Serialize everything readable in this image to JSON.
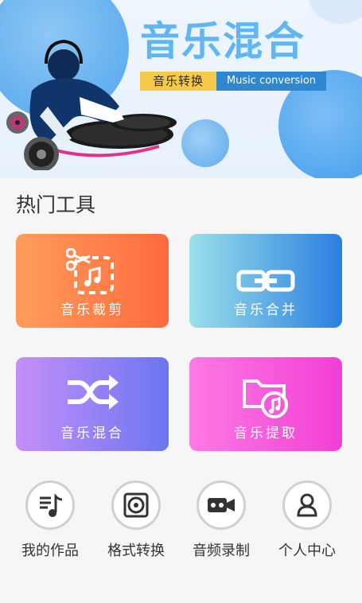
{
  "banner": {
    "title": "音乐混合",
    "tag_cn": "音乐转换",
    "tag_en": "Music conversion"
  },
  "section": {
    "title": "热门工具"
  },
  "tools": [
    {
      "label": "音乐裁剪",
      "icon": "scissors-music-icon",
      "gradient": [
        "#ff9c5b",
        "#ff6a3d"
      ]
    },
    {
      "label": "音乐合并",
      "icon": "link-icon",
      "gradient": [
        "#9be0ea",
        "#2a7fe0"
      ]
    },
    {
      "label": "音乐混合",
      "icon": "shuffle-icon",
      "gradient": [
        "#c58ff8",
        "#6c76f2"
      ]
    },
    {
      "label": "音乐提取",
      "icon": "folder-music-icon",
      "gradient": [
        "#fd7ae3",
        "#f23fd5"
      ]
    }
  ],
  "bottom_nav": [
    {
      "label": "我的作品",
      "icon": "music-list-icon"
    },
    {
      "label": "格式转换",
      "icon": "disc-icon"
    },
    {
      "label": "音频录制",
      "icon": "recorder-icon"
    },
    {
      "label": "个人中心",
      "icon": "user-icon"
    }
  ]
}
